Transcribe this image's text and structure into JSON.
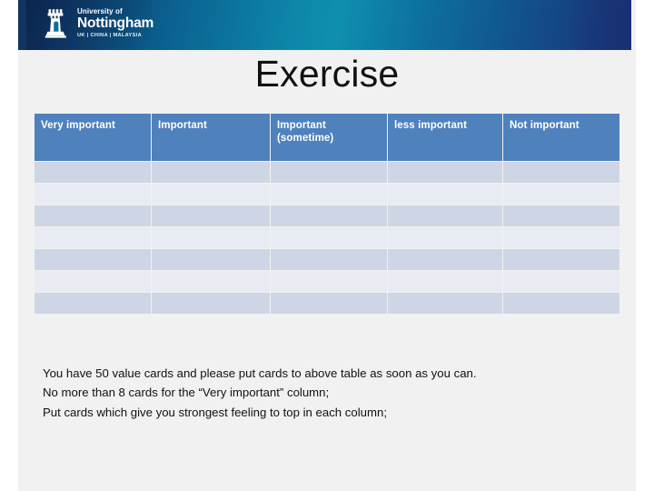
{
  "banner": {
    "logo": {
      "crest_icon": "castle-tower-crest-icon",
      "university_line": "University of",
      "name_line": "Nottingham",
      "campuses_line": "UK | CHINA | MALAYSIA"
    }
  },
  "title": "Exercise",
  "table": {
    "headers": [
      "Very important",
      "Important",
      "Important (sometime)",
      "less important",
      "Not important"
    ],
    "row_count": 7,
    "column_count": 5,
    "cells_empty": true,
    "colors": {
      "header_fill": "#4f81bd",
      "header_text": "#ffffff",
      "band_dark": "#ced5e4",
      "band_light": "#e8ebf2"
    }
  },
  "instructions": {
    "line1": "You have 50 value cards and please put cards to above table as soon as you can.",
    "line2": "No more than 8 cards for the “Very important” column;",
    "line3": "Put cards which give you strongest feeling to top in each column;"
  },
  "theme": {
    "slide_background": "#f1f1f1",
    "page_background": "#ffffff",
    "banner_dark": "#123160",
    "banner_teal": "#0f8faf",
    "title_text": "#111111"
  }
}
